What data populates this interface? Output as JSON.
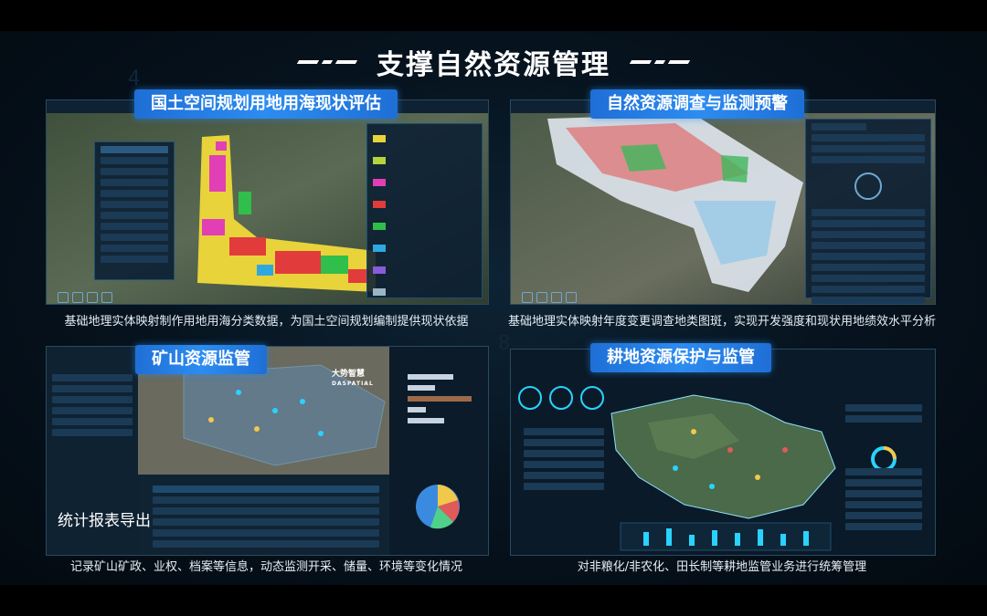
{
  "slide": {
    "title": "支撑自然资源管理"
  },
  "panels": [
    {
      "id": "p1",
      "badge": "国土空间规划用地用海现状评估",
      "caption": "基础地理实体映射制作用地用海分类数据，为国土空间规划编制提供现状依据"
    },
    {
      "id": "p2",
      "badge": "自然资源调查与监测预警",
      "caption": "基础地理实体映射年度变更调查地类图斑，实现开发强度和现状用地绩效水平分析"
    },
    {
      "id": "p3",
      "badge": "矿山资源监管",
      "caption": "记录矿山矿政、业权、档案等信息，动态监测开采、储量、环境等变化情况",
      "overlay_text": "统计报表导出",
      "brand": "大势智慧",
      "brand_en": "DASPATIAL"
    },
    {
      "id": "p4",
      "badge": "耕地资源保护与监管",
      "caption": "对非粮化/非农化、田长制等耕地监管业务进行统筹管理"
    }
  ],
  "colors": {
    "badge": "#2d8cf0",
    "background": "#06121d",
    "accent_cyan": "#29d3ff"
  },
  "background_digits": [
    "4",
    "4",
    "8"
  ]
}
